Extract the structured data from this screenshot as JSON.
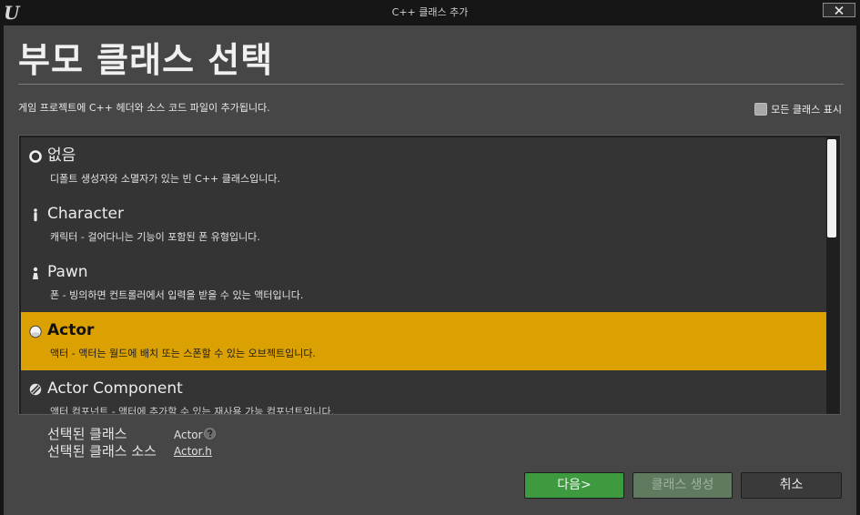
{
  "window": {
    "title": "C++ 클래스 추가",
    "logo_icon": "unreal-engine-logo",
    "close_icon": "close-icon"
  },
  "header": {
    "title": "부모 클래스 선택",
    "description": "게임 프로젝트에 C++ 헤더와 소스 코드 파일이 추가됩니다.",
    "show_all_label": "모든 클래스 표시",
    "show_all_checked": false
  },
  "class_list": {
    "selected_index": 3,
    "items": [
      {
        "name": "없음",
        "description": "디폴트 생성자와 소멸자가 있는 빈 C++ 클래스입니다.",
        "icon": "circle-icon"
      },
      {
        "name": "Character",
        "description": "캐릭터 - 걸어다니는 기능이 포함된 폰 유형입니다.",
        "icon": "character-icon"
      },
      {
        "name": "Pawn",
        "description": "폰 - 빙의하면 컨트롤러에서 입력을 받을 수 있는 액터입니다.",
        "icon": "pawn-icon"
      },
      {
        "name": "Actor",
        "description": "액터 - 액터는 월드에 배치 또는 스폰할 수 있는 오브젝트입니다.",
        "icon": "actor-sphere-icon"
      },
      {
        "name": "Actor Component",
        "description": "액터 컴포넌트 - 액터에 추가할 수 있는 재사용 가능 컴포넌트입니다.",
        "icon": "actor-component-icon"
      }
    ]
  },
  "selection": {
    "class_label": "선택된 클래스",
    "class_value": "Actor",
    "source_label": "선택된 클래스 소스",
    "source_value": "Actor.h"
  },
  "buttons": {
    "next": "다음>",
    "create": "클래스 생성",
    "cancel": "취소"
  },
  "colors": {
    "selected_row": "#dba102",
    "next_button": "#3e9a3e",
    "panel": "#464646"
  }
}
